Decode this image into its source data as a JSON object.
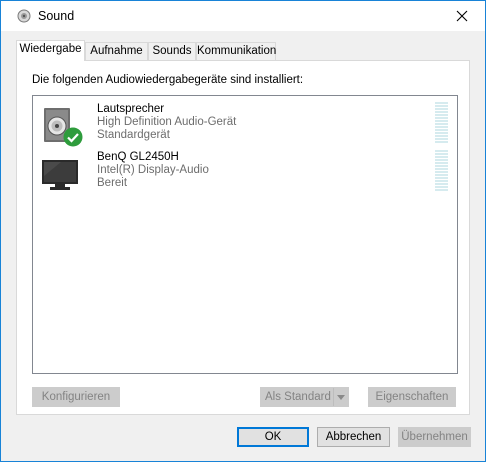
{
  "window": {
    "title": "Sound"
  },
  "tabs": [
    {
      "label": "Wiedergabe",
      "active": true
    },
    {
      "label": "Aufnahme",
      "active": false
    },
    {
      "label": "Sounds",
      "active": false
    },
    {
      "label": "Kommunikation",
      "active": false
    }
  ],
  "playback": {
    "intro": "Die folgenden Audiowiedergabegeräte sind installiert:",
    "devices": [
      {
        "name": "Lautsprecher",
        "description": "High Definition Audio-Gerät",
        "status": "Standardgerät",
        "icon": "speaker-icon",
        "badge": "default-check-icon"
      },
      {
        "name": "BenQ GL2450H",
        "description": "Intel(R) Display-Audio",
        "status": "Bereit",
        "icon": "monitor-icon"
      }
    ],
    "buttons": {
      "configure": "Konfigurieren",
      "set_default": "Als Standard",
      "properties": "Eigenschaften"
    }
  },
  "footer": {
    "ok": "OK",
    "cancel": "Abbrechen",
    "apply": "Übernehmen"
  },
  "colors": {
    "accent": "#0078d7",
    "check": "#2e9c3c",
    "meter": "#d6ebef"
  }
}
